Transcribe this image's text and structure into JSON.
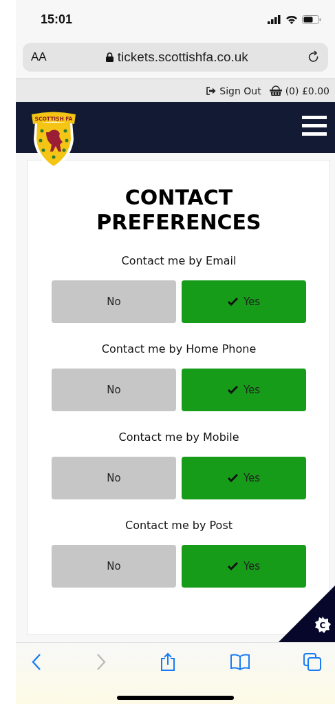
{
  "status_bar": {
    "time": "15:01"
  },
  "address_bar": {
    "text_size": "AA",
    "url": "tickets.scottishfa.co.uk"
  },
  "account_bar": {
    "sign_out": "Sign Out",
    "basket": "(0) £0.00"
  },
  "header": {
    "logo_text": "SCOTTISH FA"
  },
  "page": {
    "title": "CONTACT PREFERENCES",
    "preferences": [
      {
        "label": "Contact me by Email",
        "options": [
          {
            "label": "No",
            "selected": false
          },
          {
            "label": "Yes",
            "selected": true
          }
        ]
      },
      {
        "label": "Contact me by Home Phone",
        "options": [
          {
            "label": "No",
            "selected": false
          },
          {
            "label": "Yes",
            "selected": true
          }
        ]
      },
      {
        "label": "Contact me by Mobile",
        "options": [
          {
            "label": "No",
            "selected": false
          },
          {
            "label": "Yes",
            "selected": true
          }
        ]
      },
      {
        "label": "Contact me by Post",
        "options": [
          {
            "label": "No",
            "selected": false
          },
          {
            "label": "Yes",
            "selected": true
          }
        ]
      }
    ]
  },
  "cookie_badge": {
    "letter": "C"
  }
}
